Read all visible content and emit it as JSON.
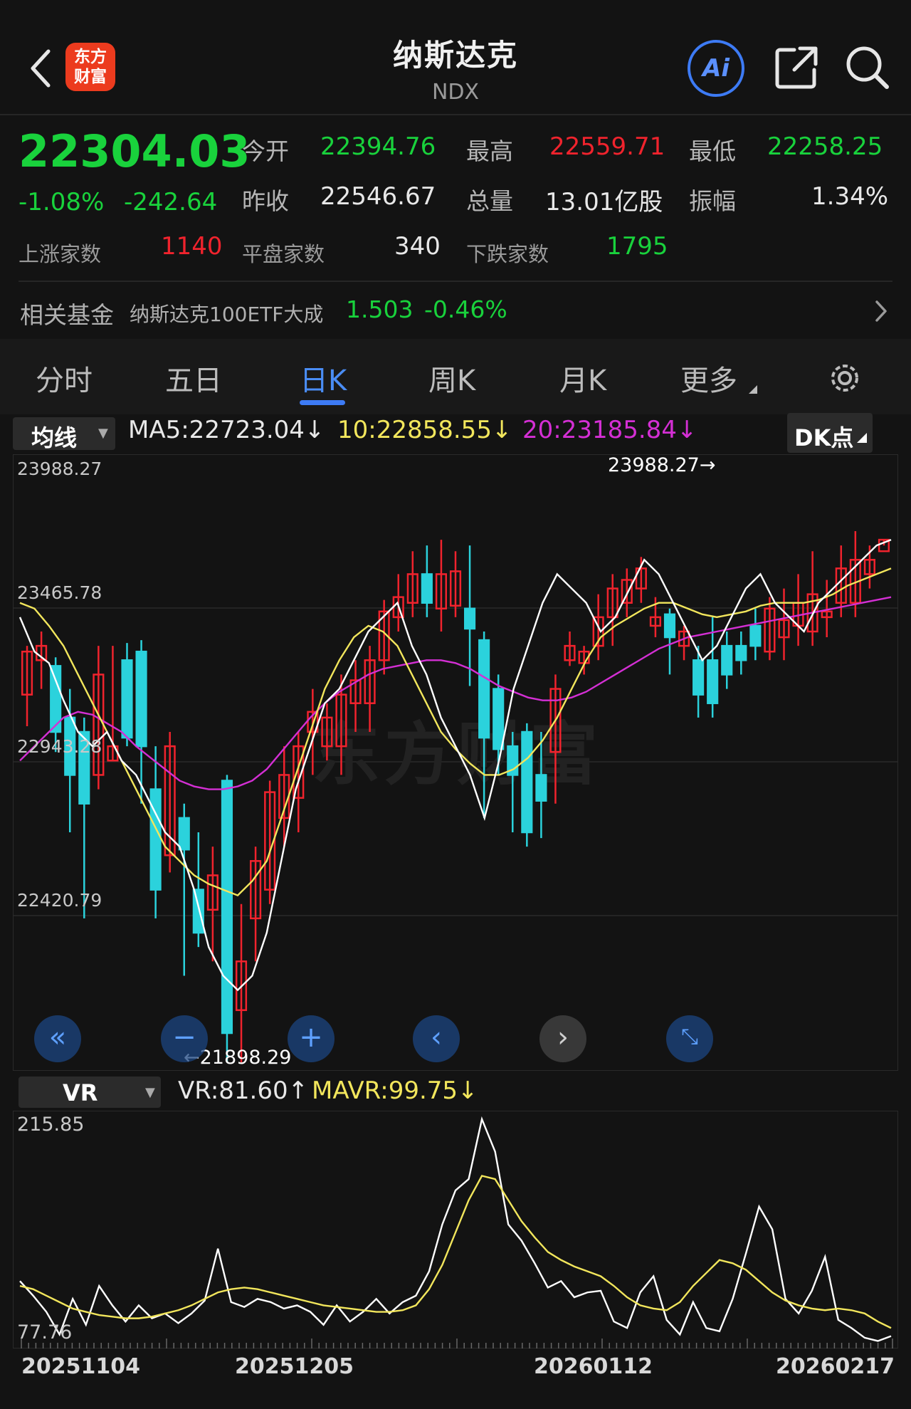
{
  "header": {
    "title": "纳斯达克",
    "subtitle": "NDX",
    "logo_line1": "东方",
    "logo_line2": "财富",
    "ai_label": "Ai"
  },
  "quote": {
    "price": "22304.03",
    "change_pct": "-1.08%",
    "change": "-242.64",
    "open_label": "今开",
    "open": "22394.76",
    "high_label": "最高",
    "high": "22559.71",
    "low_label": "最低",
    "low": "22258.25",
    "prev_label": "昨收",
    "prev": "22546.67",
    "volume_label": "总量",
    "volume": "13.01亿股",
    "amp_label": "振幅",
    "amp": "1.34%",
    "up_label": "上涨家数",
    "up": "1140",
    "flat_label": "平盘家数",
    "flat": "340",
    "down_label": "下跌家数",
    "down": "1795"
  },
  "fund": {
    "label": "相关基金",
    "name": "纳斯达克100ETF大成",
    "price": "1.503",
    "change": "-0.46%"
  },
  "tabs": [
    {
      "label": "分时"
    },
    {
      "label": "五日"
    },
    {
      "label": "日K"
    },
    {
      "label": "周K"
    },
    {
      "label": "月K"
    },
    {
      "label": "更多"
    }
  ],
  "indicator": {
    "selector": "均线",
    "ma5": "MA5:22723.04",
    "ma10": "10:22858.55",
    "ma20": "20:23185.84",
    "dk": "DK点",
    "arrow": "↓"
  },
  "price_axis": [
    "23988.27",
    "23465.78",
    "22943.28",
    "22420.79"
  ],
  "annotations": {
    "high": "23988.27→",
    "low": "←21898.29"
  },
  "vr": {
    "selector": "VR",
    "vr_value": "VR:81.60",
    "vr_arrow": "↑",
    "mavr_value": "MAVR:99.75",
    "mavr_arrow": "↓",
    "axis_max": "215.85",
    "axis_min": "77.76"
  },
  "dates": [
    "20251104",
    "20251205",
    "20260112",
    "20260217"
  ],
  "colors": {
    "up": "#f0232d",
    "down": "#2bd2dc",
    "ma5": "#ffffff",
    "ma10": "#f2e65c",
    "ma20": "#d42fd4",
    "accent": "#3d7bf5"
  },
  "chart_data": {
    "type": "candlestick",
    "ylim": [
      21898.29,
      23988.27
    ],
    "candles": [
      [
        23180,
        23330,
        23350,
        23070
      ],
      [
        23300,
        23350,
        23400,
        23200
      ],
      [
        23280,
        23050,
        23310,
        22980
      ],
      [
        23100,
        22900,
        23200,
        22700
      ],
      [
        23050,
        22800,
        23100,
        22400
      ],
      [
        22900,
        23250,
        23350,
        22850
      ],
      [
        22950,
        23000,
        23350,
        22950
      ],
      [
        23300,
        23030,
        23360,
        23000
      ],
      [
        23330,
        23000,
        23370,
        22800
      ],
      [
        22850,
        22500,
        23000,
        22400
      ],
      [
        22620,
        23000,
        23050,
        22560
      ],
      [
        22750,
        22640,
        22800,
        22200
      ],
      [
        22500,
        22350,
        22700,
        22300
      ],
      [
        22430,
        22550,
        22650,
        22250
      ],
      [
        22880,
        22000,
        22900,
        21900
      ],
      [
        22080,
        22250,
        22450,
        21898
      ],
      [
        22400,
        22600,
        22650,
        22250
      ],
      [
        22500,
        22840,
        22880,
        22450
      ],
      [
        22750,
        22900,
        23000,
        22650
      ],
      [
        22820,
        23000,
        23050,
        22700
      ],
      [
        23050,
        23120,
        23200,
        22900
      ],
      [
        23000,
        23100,
        23150,
        22950
      ],
      [
        23000,
        23180,
        23250,
        22900
      ],
      [
        23150,
        23230,
        23300,
        23050
      ],
      [
        23150,
        23300,
        23350,
        23050
      ],
      [
        23300,
        23470,
        23510,
        23250
      ],
      [
        23450,
        23520,
        23600,
        23400
      ],
      [
        23500,
        23600,
        23680,
        23450
      ],
      [
        23600,
        23500,
        23700,
        23450
      ],
      [
        23480,
        23600,
        23720,
        23400
      ],
      [
        23490,
        23610,
        23680,
        23450
      ],
      [
        23480,
        23410,
        23700,
        23210
      ],
      [
        23370,
        23030,
        23400,
        22750
      ],
      [
        23200,
        22990,
        23250,
        22900
      ],
      [
        23000,
        22900,
        23050,
        22700
      ],
      [
        23050,
        22700,
        23080,
        22650
      ],
      [
        22900,
        22810,
        23050,
        22680
      ],
      [
        22980,
        23200,
        23250,
        22800
      ],
      [
        23300,
        23350,
        23400,
        23280
      ],
      [
        23290,
        23330,
        23350,
        23250
      ],
      [
        23350,
        23450,
        23530,
        23300
      ],
      [
        23450,
        23550,
        23600,
        23350
      ],
      [
        23500,
        23580,
        23620,
        23450
      ],
      [
        23550,
        23620,
        23660,
        23500
      ],
      [
        23420,
        23450,
        23520,
        23380
      ],
      [
        23460,
        23380,
        23480,
        23250
      ],
      [
        23350,
        23400,
        23420,
        23300
      ],
      [
        23300,
        23180,
        23350,
        23100
      ],
      [
        23300,
        23150,
        23450,
        23100
      ],
      [
        23350,
        23250,
        23400,
        23200
      ],
      [
        23350,
        23300,
        23400,
        23250
      ],
      [
        23420,
        23350,
        23480,
        23300
      ],
      [
        23330,
        23480,
        23520,
        23300
      ],
      [
        23380,
        23440,
        23550,
        23300
      ],
      [
        23420,
        23500,
        23600,
        23350
      ],
      [
        23400,
        23530,
        23680,
        23350
      ],
      [
        23450,
        23470,
        23580,
        23380
      ],
      [
        23500,
        23620,
        23700,
        23450
      ],
      [
        23500,
        23650,
        23750,
        23450
      ],
      [
        23600,
        23650,
        23700,
        23550
      ],
      [
        23680,
        23720,
        23720,
        23700
      ]
    ],
    "ma5": [
      23450,
      23330,
      23290,
      23160,
      23050,
      23000,
      23050,
      22950,
      22900,
      22800,
      22700,
      22650,
      22500,
      22300,
      22200,
      22150,
      22200,
      22350,
      22600,
      22850,
      23000,
      23150,
      23200,
      23300,
      23400,
      23450,
      23500,
      23350,
      23250,
      23100,
      23000,
      22900,
      22750,
      22950,
      23200,
      23350,
      23500,
      23600,
      23550,
      23500,
      23400,
      23450,
      23550,
      23650,
      23600,
      23500,
      23400,
      23300,
      23350,
      23450,
      23550,
      23600,
      23500,
      23450,
      23400,
      23500,
      23550,
      23600,
      23650,
      23700,
      23720
    ],
    "ma10": [
      23500,
      23480,
      23420,
      23350,
      23250,
      23150,
      23050,
      22950,
      22850,
      22750,
      22650,
      22600,
      22550,
      22520,
      22500,
      22480,
      22530,
      22600,
      22750,
      22900,
      23050,
      23200,
      23300,
      23380,
      23420,
      23400,
      23350,
      23250,
      23150,
      23050,
      22990,
      22940,
      22900,
      22900,
      22920,
      22960,
      23020,
      23100,
      23200,
      23300,
      23380,
      23420,
      23450,
      23480,
      23500,
      23500,
      23480,
      23460,
      23450,
      23460,
      23470,
      23490,
      23500,
      23500,
      23500,
      23510,
      23530,
      23560,
      23580,
      23600,
      23620
    ],
    "ma20": [
      22950,
      23000,
      23050,
      23100,
      23120,
      23110,
      23080,
      23050,
      23000,
      22960,
      22920,
      22880,
      22860,
      22850,
      22850,
      22860,
      22880,
      22920,
      22980,
      23040,
      23100,
      23150,
      23190,
      23220,
      23250,
      23270,
      23280,
      23290,
      23300,
      23300,
      23290,
      23270,
      23240,
      23210,
      23190,
      23170,
      23160,
      23160,
      23170,
      23190,
      23220,
      23250,
      23280,
      23310,
      23340,
      23360,
      23380,
      23390,
      23400,
      23410,
      23420,
      23430,
      23440,
      23450,
      23460,
      23470,
      23480,
      23490,
      23500,
      23510,
      23520
    ]
  }
}
